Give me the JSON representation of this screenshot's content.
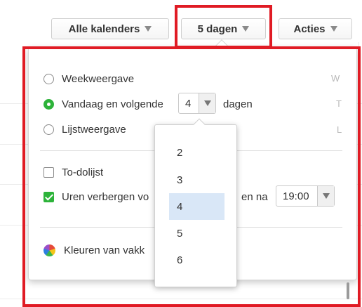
{
  "toolbar": {
    "calendars_label": "Alle kalenders",
    "days_label": "5 dagen",
    "actions_label": "Acties"
  },
  "view_options": {
    "week": {
      "label": "Weekweergave",
      "shortcut": "W",
      "selected": false
    },
    "today": {
      "label_before": "Vandaag en volgende",
      "days_value": "4",
      "label_after": "dagen",
      "shortcut": "T",
      "selected": true
    },
    "list": {
      "label": "Lijstweergave",
      "shortcut": "L",
      "selected": false
    }
  },
  "todo": {
    "label": "To-dolijst",
    "checked": false
  },
  "hours": {
    "label_start": "Uren verbergen vo",
    "label_end": "en na",
    "end_time": "19:00",
    "checked": true
  },
  "colors": {
    "label": "Kleuren van vakk"
  },
  "days_dropdown": {
    "options": [
      "2",
      "3",
      "4",
      "5",
      "6"
    ],
    "selected": "4"
  },
  "accent_colors": {
    "highlight": "#e01b24",
    "check": "#2db33a",
    "selected_option": "#d9e7f7"
  }
}
